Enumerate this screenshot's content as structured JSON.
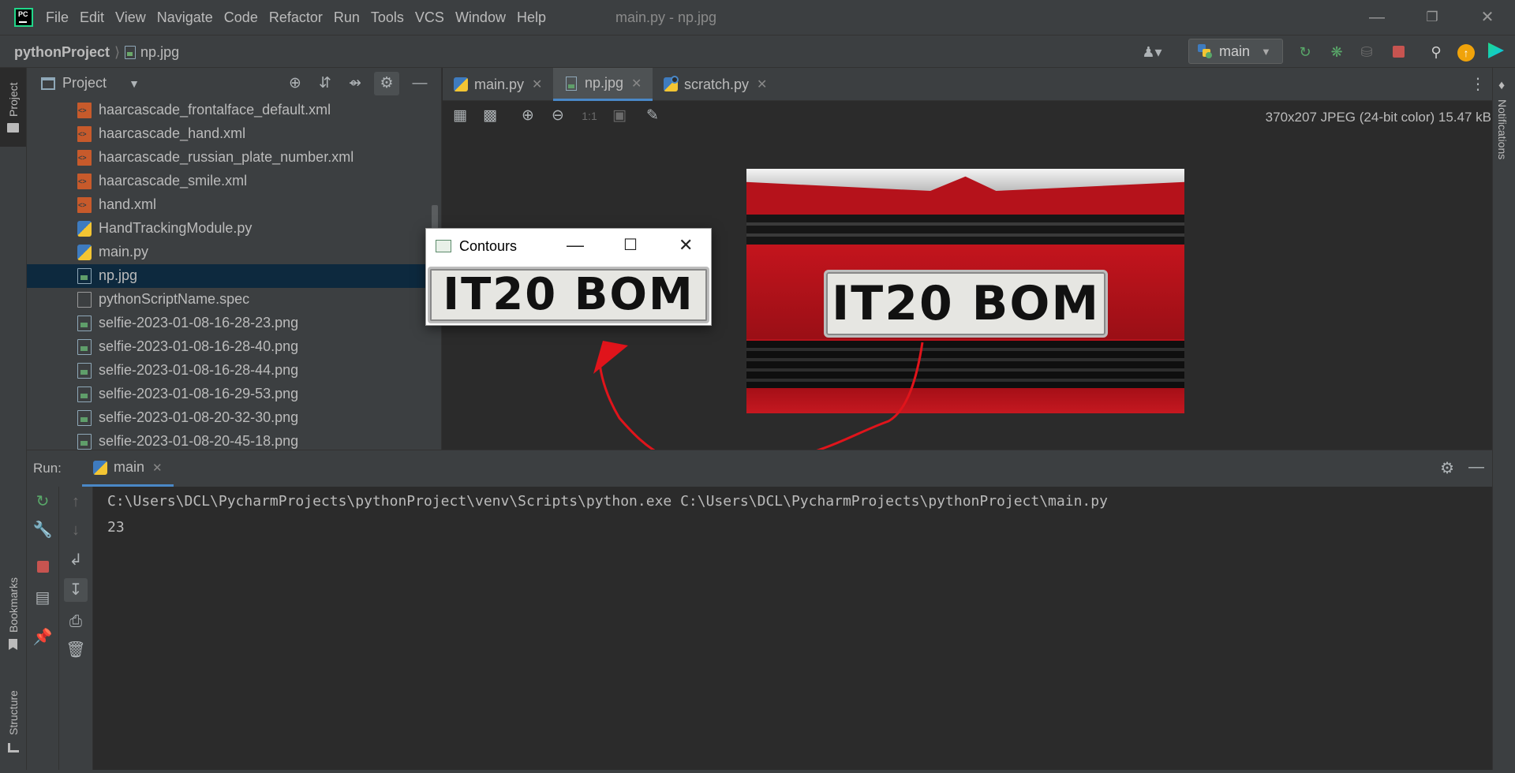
{
  "app": {
    "logo_text": "PC",
    "window_title": "main.py - np.jpg"
  },
  "menu": [
    "File",
    "Edit",
    "View",
    "Navigate",
    "Code",
    "Refactor",
    "Run",
    "Tools",
    "VCS",
    "Window",
    "Help"
  ],
  "breadcrumb": {
    "project": "pythonProject",
    "file": "np.jpg"
  },
  "run_config": {
    "label": "main"
  },
  "left_strip": {
    "project": "Project",
    "bookmarks": "Bookmarks",
    "structure": "Structure"
  },
  "right_strip": {
    "notifications": "Notifications"
  },
  "project_panel": {
    "title": "Project",
    "files": [
      {
        "name": "haarcascade_frontalface_default.xml",
        "type": "xml"
      },
      {
        "name": "haarcascade_hand.xml",
        "type": "xml"
      },
      {
        "name": "haarcascade_russian_plate_number.xml",
        "type": "xml"
      },
      {
        "name": "haarcascade_smile.xml",
        "type": "xml"
      },
      {
        "name": "hand.xml",
        "type": "xml"
      },
      {
        "name": "HandTrackingModule.py",
        "type": "py"
      },
      {
        "name": "main.py",
        "type": "py"
      },
      {
        "name": "np.jpg",
        "type": "img",
        "selected": true
      },
      {
        "name": "pythonScriptName.spec",
        "type": "spec"
      },
      {
        "name": "selfie-2023-01-08-16-28-23.png",
        "type": "img"
      },
      {
        "name": "selfie-2023-01-08-16-28-40.png",
        "type": "img"
      },
      {
        "name": "selfie-2023-01-08-16-28-44.png",
        "type": "img"
      },
      {
        "name": "selfie-2023-01-08-16-29-53.png",
        "type": "img"
      },
      {
        "name": "selfie-2023-01-08-20-32-30.png",
        "type": "img"
      },
      {
        "name": "selfie-2023-01-08-20-45-18.png",
        "type": "img"
      }
    ]
  },
  "editor": {
    "tabs": [
      {
        "label": "main.py",
        "icon": "python-file-icon"
      },
      {
        "label": "np.jpg",
        "icon": "image-file-icon",
        "active": true
      },
      {
        "label": "scratch.py",
        "icon": "scratch-file-icon"
      }
    ],
    "image_info": "370x207 JPEG (24-bit color) 15.47 kB",
    "zoom_actual": "1:1",
    "plate_text": "IT20 BOM"
  },
  "contours_window": {
    "title": "Contours",
    "plate_text": "IT20 BOM"
  },
  "run_panel": {
    "label": "Run:",
    "tab": "main",
    "console_lines": [
      "C:\\Users\\DCL\\PycharmProjects\\pythonProject\\venv\\Scripts\\python.exe C:\\Users\\DCL\\PycharmProjects\\pythonProject\\main.py",
      "23"
    ]
  },
  "colors": {
    "accent": "#4a88c7",
    "selection": "#0d293e",
    "annotation_arrow": "#e0141b",
    "car_red": "#b5121b"
  }
}
